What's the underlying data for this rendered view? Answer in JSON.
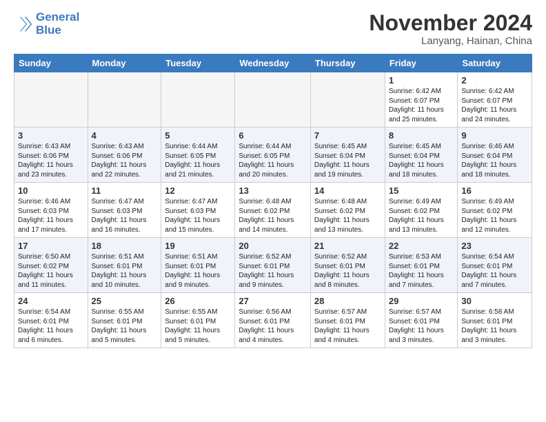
{
  "logo": {
    "line1": "General",
    "line2": "Blue"
  },
  "header": {
    "month": "November 2024",
    "location": "Lanyang, Hainan, China"
  },
  "weekdays": [
    "Sunday",
    "Monday",
    "Tuesday",
    "Wednesday",
    "Thursday",
    "Friday",
    "Saturday"
  ],
  "weeks": [
    [
      {
        "day": "",
        "empty": true
      },
      {
        "day": "",
        "empty": true
      },
      {
        "day": "",
        "empty": true
      },
      {
        "day": "",
        "empty": true
      },
      {
        "day": "",
        "empty": true
      },
      {
        "day": "1",
        "info": "Sunrise: 6:42 AM\nSunset: 6:07 PM\nDaylight: 11 hours\nand 25 minutes."
      },
      {
        "day": "2",
        "info": "Sunrise: 6:42 AM\nSunset: 6:07 PM\nDaylight: 11 hours\nand 24 minutes."
      }
    ],
    [
      {
        "day": "3",
        "info": "Sunrise: 6:43 AM\nSunset: 6:06 PM\nDaylight: 11 hours\nand 23 minutes."
      },
      {
        "day": "4",
        "info": "Sunrise: 6:43 AM\nSunset: 6:06 PM\nDaylight: 11 hours\nand 22 minutes."
      },
      {
        "day": "5",
        "info": "Sunrise: 6:44 AM\nSunset: 6:05 PM\nDaylight: 11 hours\nand 21 minutes."
      },
      {
        "day": "6",
        "info": "Sunrise: 6:44 AM\nSunset: 6:05 PM\nDaylight: 11 hours\nand 20 minutes."
      },
      {
        "day": "7",
        "info": "Sunrise: 6:45 AM\nSunset: 6:04 PM\nDaylight: 11 hours\nand 19 minutes."
      },
      {
        "day": "8",
        "info": "Sunrise: 6:45 AM\nSunset: 6:04 PM\nDaylight: 11 hours\nand 18 minutes."
      },
      {
        "day": "9",
        "info": "Sunrise: 6:46 AM\nSunset: 6:04 PM\nDaylight: 11 hours\nand 18 minutes."
      }
    ],
    [
      {
        "day": "10",
        "info": "Sunrise: 6:46 AM\nSunset: 6:03 PM\nDaylight: 11 hours\nand 17 minutes."
      },
      {
        "day": "11",
        "info": "Sunrise: 6:47 AM\nSunset: 6:03 PM\nDaylight: 11 hours\nand 16 minutes."
      },
      {
        "day": "12",
        "info": "Sunrise: 6:47 AM\nSunset: 6:03 PM\nDaylight: 11 hours\nand 15 minutes."
      },
      {
        "day": "13",
        "info": "Sunrise: 6:48 AM\nSunset: 6:02 PM\nDaylight: 11 hours\nand 14 minutes."
      },
      {
        "day": "14",
        "info": "Sunrise: 6:48 AM\nSunset: 6:02 PM\nDaylight: 11 hours\nand 13 minutes."
      },
      {
        "day": "15",
        "info": "Sunrise: 6:49 AM\nSunset: 6:02 PM\nDaylight: 11 hours\nand 13 minutes."
      },
      {
        "day": "16",
        "info": "Sunrise: 6:49 AM\nSunset: 6:02 PM\nDaylight: 11 hours\nand 12 minutes."
      }
    ],
    [
      {
        "day": "17",
        "info": "Sunrise: 6:50 AM\nSunset: 6:02 PM\nDaylight: 11 hours\nand 11 minutes."
      },
      {
        "day": "18",
        "info": "Sunrise: 6:51 AM\nSunset: 6:01 PM\nDaylight: 11 hours\nand 10 minutes."
      },
      {
        "day": "19",
        "info": "Sunrise: 6:51 AM\nSunset: 6:01 PM\nDaylight: 11 hours\nand 9 minutes."
      },
      {
        "day": "20",
        "info": "Sunrise: 6:52 AM\nSunset: 6:01 PM\nDaylight: 11 hours\nand 9 minutes."
      },
      {
        "day": "21",
        "info": "Sunrise: 6:52 AM\nSunset: 6:01 PM\nDaylight: 11 hours\nand 8 minutes."
      },
      {
        "day": "22",
        "info": "Sunrise: 6:53 AM\nSunset: 6:01 PM\nDaylight: 11 hours\nand 7 minutes."
      },
      {
        "day": "23",
        "info": "Sunrise: 6:54 AM\nSunset: 6:01 PM\nDaylight: 11 hours\nand 7 minutes."
      }
    ],
    [
      {
        "day": "24",
        "info": "Sunrise: 6:54 AM\nSunset: 6:01 PM\nDaylight: 11 hours\nand 6 minutes."
      },
      {
        "day": "25",
        "info": "Sunrise: 6:55 AM\nSunset: 6:01 PM\nDaylight: 11 hours\nand 5 minutes."
      },
      {
        "day": "26",
        "info": "Sunrise: 6:55 AM\nSunset: 6:01 PM\nDaylight: 11 hours\nand 5 minutes."
      },
      {
        "day": "27",
        "info": "Sunrise: 6:56 AM\nSunset: 6:01 PM\nDaylight: 11 hours\nand 4 minutes."
      },
      {
        "day": "28",
        "info": "Sunrise: 6:57 AM\nSunset: 6:01 PM\nDaylight: 11 hours\nand 4 minutes."
      },
      {
        "day": "29",
        "info": "Sunrise: 6:57 AM\nSunset: 6:01 PM\nDaylight: 11 hours\nand 3 minutes."
      },
      {
        "day": "30",
        "info": "Sunrise: 6:58 AM\nSunset: 6:01 PM\nDaylight: 11 hours\nand 3 minutes."
      }
    ]
  ]
}
